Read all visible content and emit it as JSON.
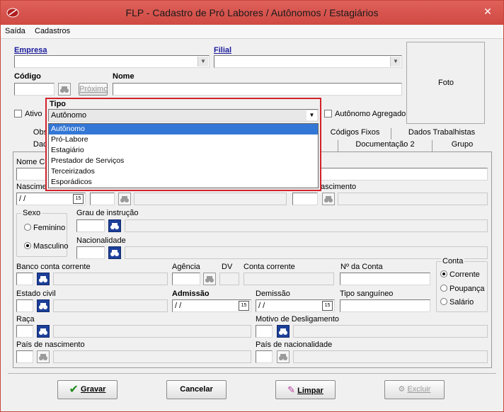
{
  "window": {
    "title": "FLP - Cadastro de Pró Labores / Autônomos / Estagiários",
    "close_glyph": "✕"
  },
  "menu": [
    "Saída",
    "Cadastros"
  ],
  "header": {
    "empresa_label": "Empresa",
    "filial_label": "Filial",
    "codigo_label": "Código",
    "nome_label": "Nome",
    "proximo_label": "Próximo",
    "foto_label": "Foto",
    "ativo_label": "Ativo",
    "autonomo_agregado_label": "Autônomo Agregado",
    "tipo_label": "Tipo",
    "tipo_value": "Autônomo"
  },
  "tipo_options": [
    "Autônomo",
    "Pró-Labore",
    "Estagiário",
    "Prestador de Serviços",
    "Terceirizados",
    "Esporádicos"
  ],
  "tipo_selected_index": 0,
  "tabs_row1": [
    "Obs",
    "Códigos Fixos",
    "Dados Trabalhistas"
  ],
  "tabs_row2": [
    "Dad",
    "Documentação 2",
    "Grupo"
  ],
  "form": {
    "nome_completo_label": "Nome Co",
    "nascimento_label": "Nascime",
    "nascimento_value": "/ /",
    "mun_nascimento_label": "ascimento",
    "sexo_label": "Sexo",
    "feminino_label": "Feminino",
    "masculino_label": "Masculino",
    "grau_instrucao_label": "Grau de instrução",
    "nacionalidade_label": "Nacionalidade",
    "banco_label": "Banco conta corrente",
    "agencia_label": "Agência",
    "dv_label": "DV",
    "conta_corrente_label": "Conta corrente",
    "n_conta_label": "Nº da Conta",
    "conta_group_label": "Conta",
    "corrente_label": "Corrente",
    "poupanca_label": "Poupança",
    "salario_label": "Salário",
    "estado_civil_label": "Estado civil",
    "admissao_label": "Admissão",
    "admissao_value": "/ /",
    "demissao_label": "Demissão",
    "demissao_value": "/ /",
    "tipo_sanguineo_label": "Tipo sanguíneo",
    "raca_label": "Raça",
    "motivo_desligamento_label": "Motivo de Desligamento",
    "pais_nascimento_label": "País de nascimento",
    "pais_nacionalidade_label": "País de nacionalidade"
  },
  "buttons": {
    "gravar": "Gravar",
    "cancelar": "Cancelar",
    "limpar": "Limpar",
    "excluir": "Excluir"
  },
  "colors": {
    "titlebar": "#d9534f",
    "highlight": "#d2232a",
    "selection": "#3377d6",
    "label_blue": "#1b1b9c"
  }
}
